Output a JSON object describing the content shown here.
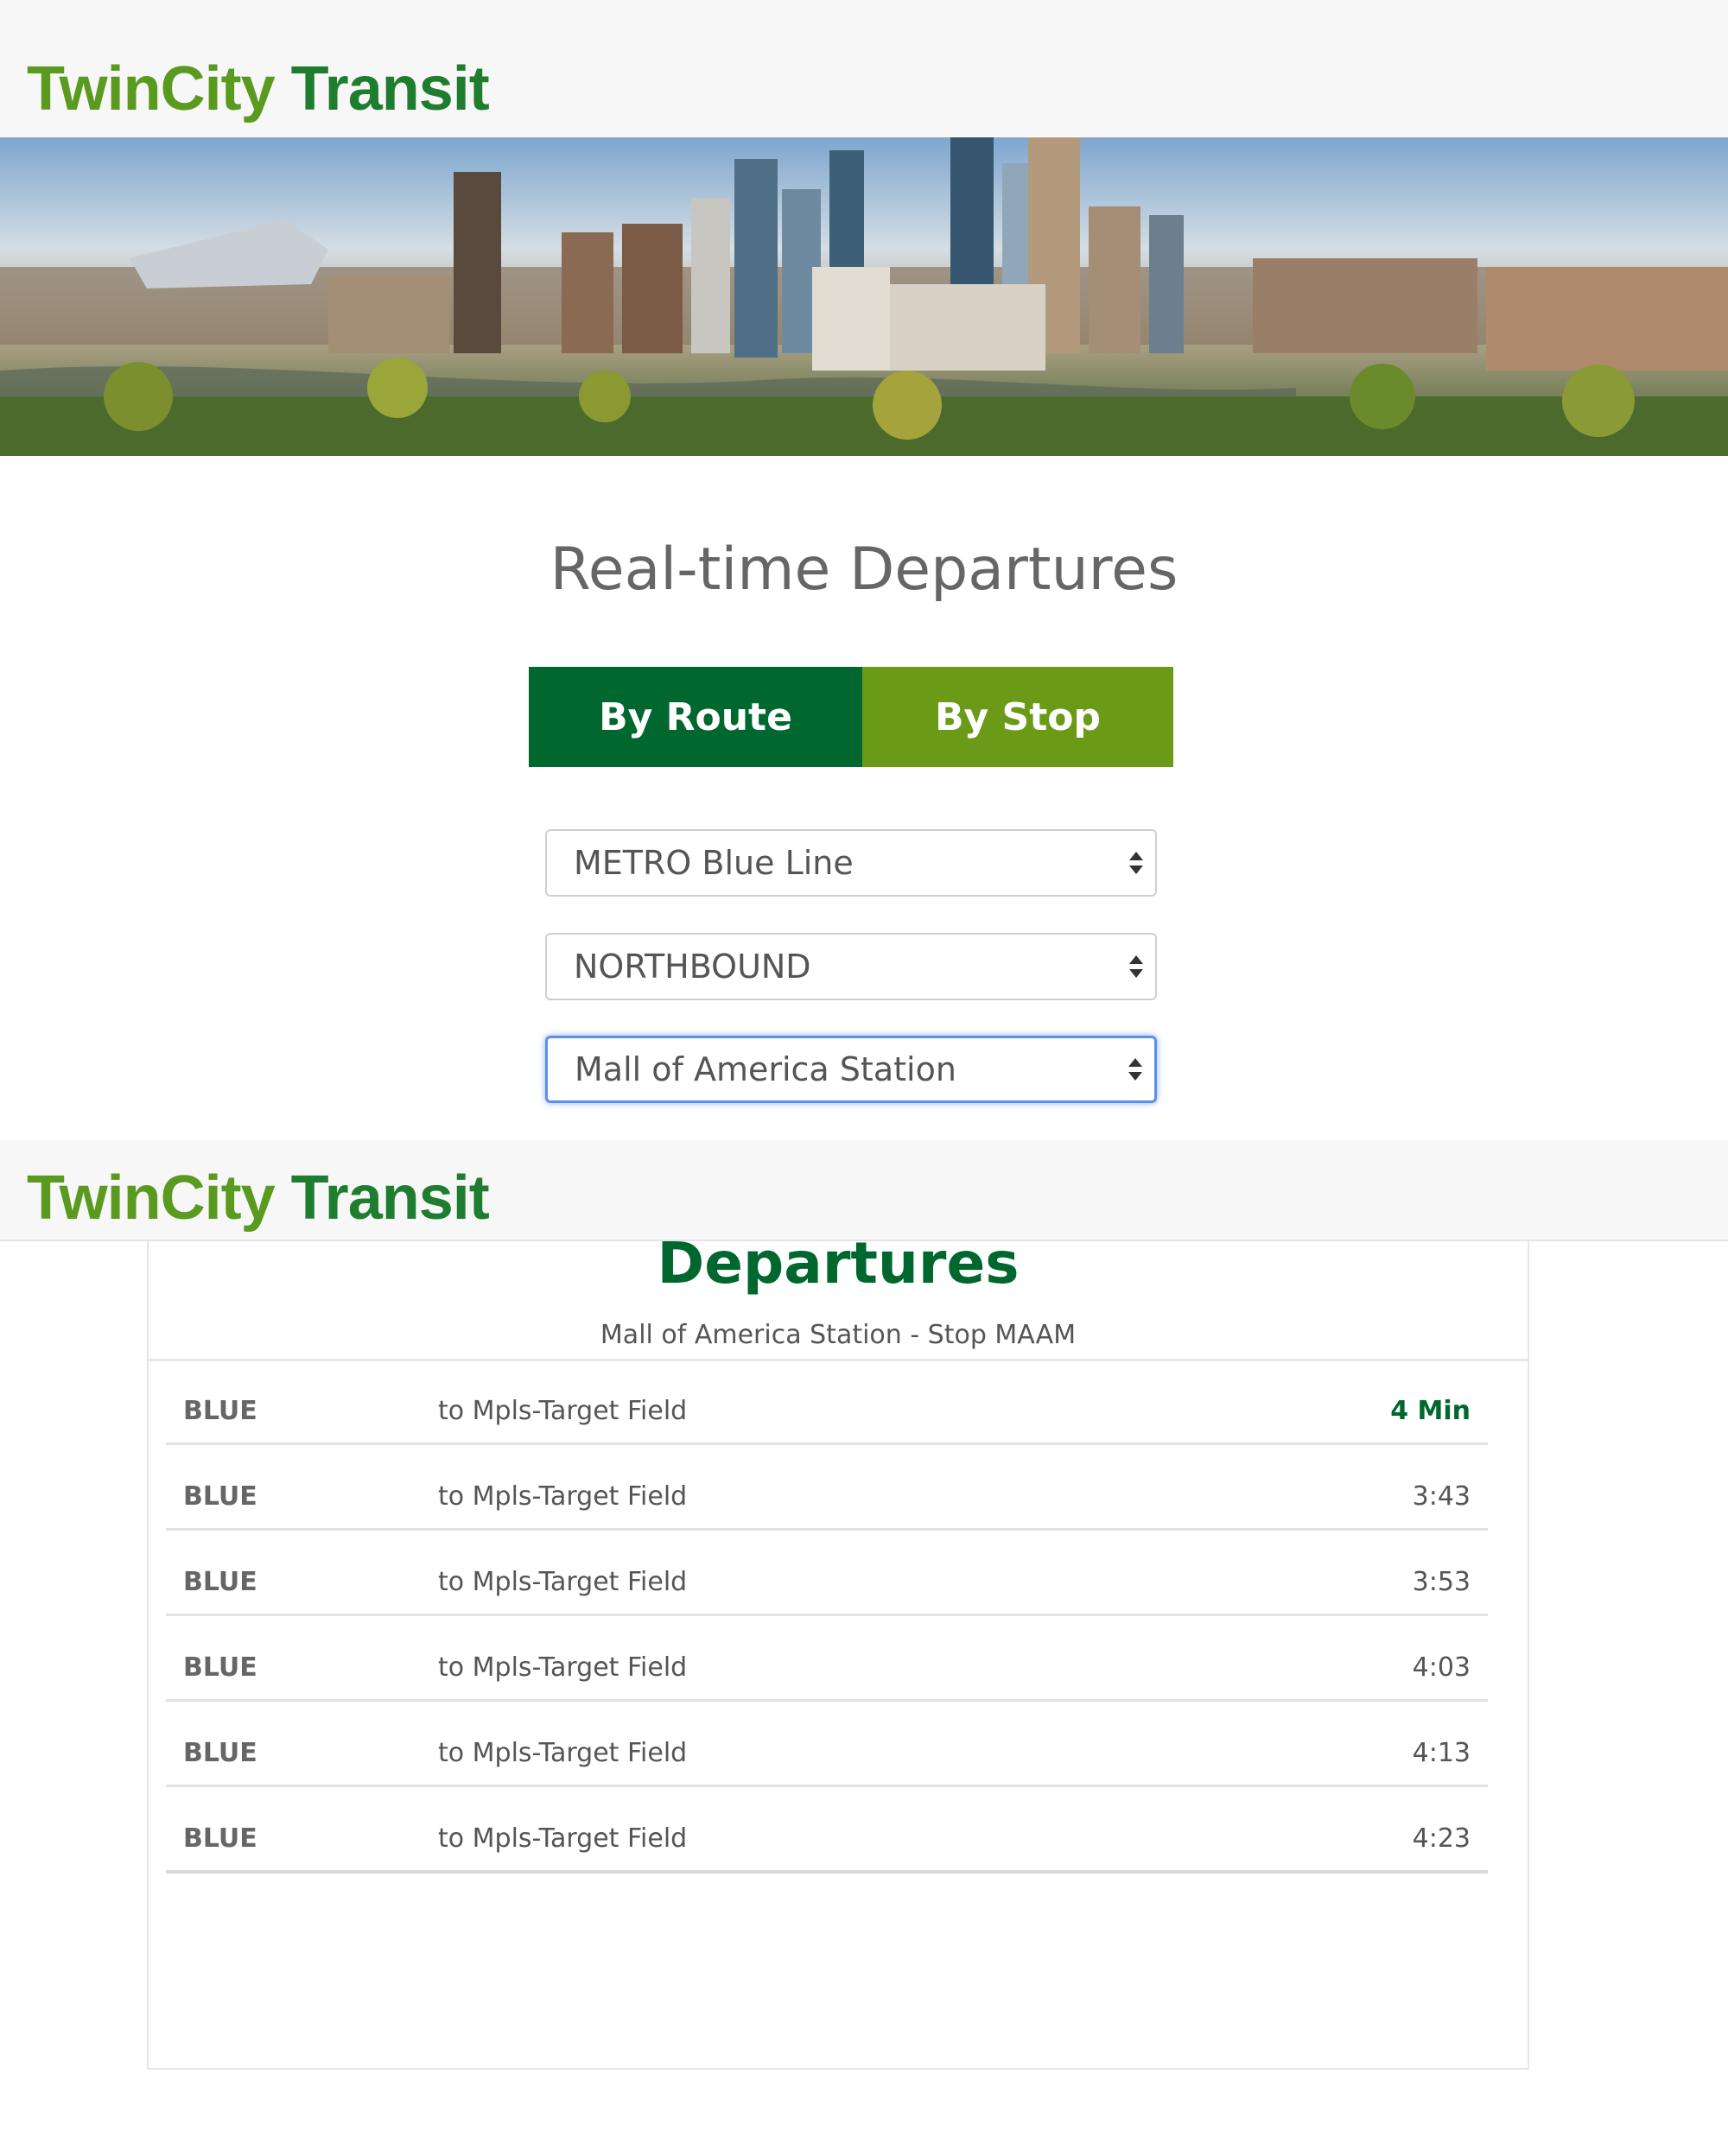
{
  "brand": {
    "part1": "TwinCity",
    "part2": "Transit"
  },
  "page": {
    "title": "Real-time Departures"
  },
  "tabs": [
    {
      "label": "By Route"
    },
    {
      "label": "By Stop"
    }
  ],
  "selects": {
    "route": "METRO Blue Line",
    "direction": "NORTHBOUND",
    "stop": "Mall of America Station"
  },
  "departures": {
    "title": "Departures",
    "subtitle": "Mall of America Station - Stop MAAM",
    "rows": [
      {
        "route": "BLUE",
        "destination": "to Mpls-Target Field",
        "time": "4 Min"
      },
      {
        "route": "BLUE",
        "destination": "to Mpls-Target Field",
        "time": "3:43"
      },
      {
        "route": "BLUE",
        "destination": "to Mpls-Target Field",
        "time": "3:53"
      },
      {
        "route": "BLUE",
        "destination": "to Mpls-Target Field",
        "time": "4:03"
      },
      {
        "route": "BLUE",
        "destination": "to Mpls-Target Field",
        "time": "4:13"
      },
      {
        "route": "BLUE",
        "destination": "to Mpls-Target Field",
        "time": "4:23"
      }
    ]
  },
  "colors": {
    "primary_green": "#00672f",
    "light_green": "#6b9a16",
    "logo_green_light": "#5a9a1f",
    "logo_green_dark": "#1f7d30",
    "focus_blue": "#5b8fe8"
  }
}
